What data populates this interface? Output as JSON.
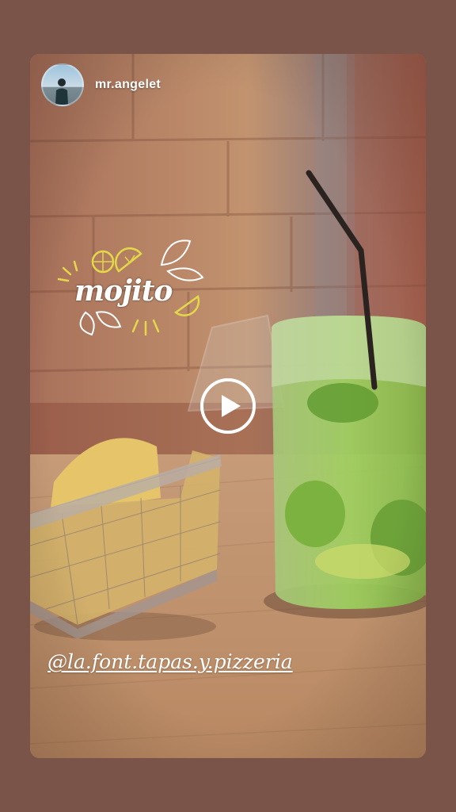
{
  "story": {
    "username": "mr.angelet",
    "sticker_text": "mojito",
    "mention": "@la.font.tapas.y.pizzeria"
  },
  "icons": {
    "play": "play-icon",
    "avatar": "avatar"
  },
  "colors": {
    "background": "#7a5448",
    "brick": "#b5785e",
    "table": "#c9a07a",
    "drink": "#8fbf4a",
    "sticker_accent": "#e3d84a",
    "text": "#ffffff"
  }
}
